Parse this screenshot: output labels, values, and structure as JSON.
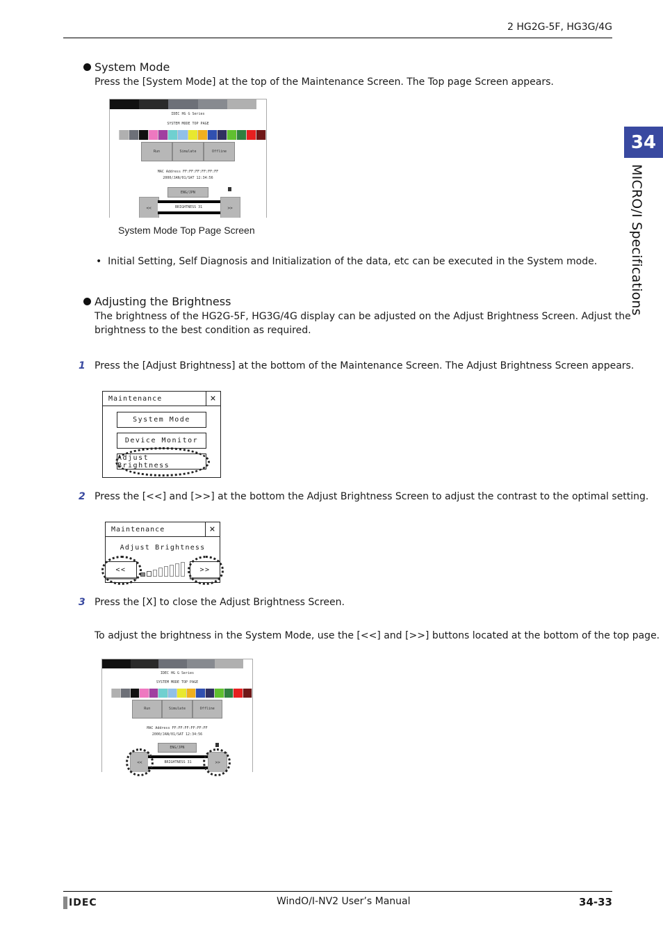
{
  "header": {
    "section": "2 HG2G-5F, HG3G/4G"
  },
  "chapter": {
    "number": "34",
    "title": "MICRO/I Specifications"
  },
  "system_mode": {
    "heading": "System Mode",
    "intro": "Press the [System Mode] at the top of the Maintenance Screen. The Top page Screen appears.",
    "caption": "System Mode Top Page Screen",
    "bullet": "Initial Setting, Self Diagnosis and Initialization of the data, etc can be executed in the System mode."
  },
  "hmi_top": {
    "series": "IDEC HG G Series",
    "page_title": "SYSTEM MODE TOP PAGE",
    "gray_strip": [
      "#111111",
      "#111111",
      "#111111",
      "#2a2a2a",
      "#2a2a2a",
      "#2a2a2a",
      "#6d7078",
      "#6d7078",
      "#6d7078",
      "#878a90",
      "#878a90",
      "#878a90",
      "#b0b0b0",
      "#b0b0b0",
      "#b0b0b0",
      "#ffffff"
    ],
    "color_strip": [
      "#ffffff",
      "#b0b0b0",
      "#6d7078",
      "#111111",
      "#ee78c0",
      "#a040a0",
      "#70d0d0",
      "#90c0e8",
      "#e8e830",
      "#f0b020",
      "#3050b0",
      "#303060",
      "#60c030",
      "#308040",
      "#e82020",
      "#701818"
    ],
    "buttons": [
      "Run",
      "Simulate",
      "Offline"
    ],
    "mac": "MAC Address  FF:FF:FF:FF:FF:FF",
    "datetime": "2000/JAN/01/SAT  12:34:56",
    "lang_button": "ENG/JPN",
    "prev": "<<",
    "next": ">>",
    "brightness": "BRIGHTNESS 31"
  },
  "brightness": {
    "heading": "Adjusting the Brightness",
    "intro_line1": "The brightness of the HG2G-5F, HG3G/4G display can be adjusted on the Adjust Brightness Screen. Adjust the",
    "intro_line2": "brightness to the best condition as required.",
    "steps": [
      {
        "num": "1",
        "text": "Press the [Adjust Brightness] at the bottom of the Maintenance Screen. The Adjust Brightness Screen appears."
      },
      {
        "num": "2",
        "text": "Press the [<<] and [>>] at the bottom the Adjust Brightness Screen to adjust the contrast to the optimal setting."
      },
      {
        "num": "3",
        "text": "Press the [X] to close the Adjust Brightness Screen."
      }
    ],
    "note": "To adjust the brightness in the System Mode, use the [<<] and [>>] buttons located at the bottom of the top page."
  },
  "maintenance_dialog": {
    "title": "Maintenance",
    "close": "×",
    "buttons": [
      "System Mode",
      "Device Monitor",
      "Adjust Brightness"
    ]
  },
  "adjust_dialog": {
    "title": "Maintenance",
    "close": "×",
    "label": "Adjust Brightness",
    "prev": "<<",
    "next": ">>",
    "level_bars": 8
  },
  "footer": {
    "logo": "IDEC",
    "manual": "WindO/I-NV2 User’s Manual",
    "page": "34-33"
  }
}
